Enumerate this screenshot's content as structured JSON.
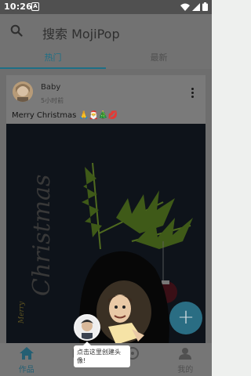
{
  "status_bar": {
    "time": "10:26",
    "notification_letter": "A"
  },
  "header": {
    "search_label": "搜索 MojiPop"
  },
  "tabs": [
    {
      "label": "热门",
      "active": true
    },
    {
      "label": "最新",
      "active": false
    }
  ],
  "post": {
    "username": "Baby",
    "time": "5小时前",
    "caption": "Merry Christmas 🙏🎅🎄💋",
    "image_text": "Merry Christmas"
  },
  "fab": {
    "label": "+"
  },
  "bottom_nav": [
    {
      "label": "作品",
      "icon": "home-icon",
      "active": true
    },
    {
      "label": "",
      "icon": "create-icon",
      "active": false
    },
    {
      "label": "",
      "icon": "discover-icon",
      "active": false
    },
    {
      "label": "我的",
      "icon": "profile-icon",
      "active": false
    }
  ],
  "tooltip": {
    "text": "点击这里创建头像!"
  },
  "colors": {
    "accent": "#1e6f86",
    "fab": "#2a6d83",
    "overlay": "#727272"
  }
}
